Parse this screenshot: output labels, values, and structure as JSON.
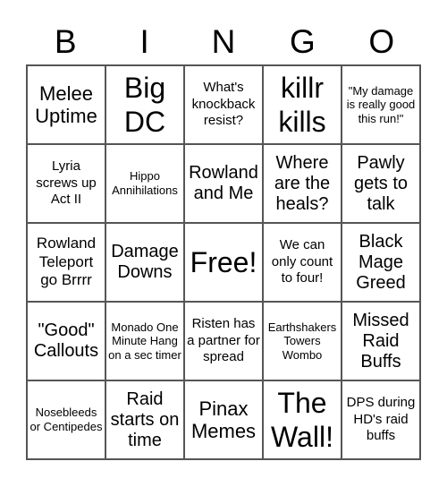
{
  "header": {
    "letters": [
      "B",
      "I",
      "N",
      "G",
      "O"
    ]
  },
  "cells": [
    "Melee Uptime",
    "Big DC",
    "What's knockback resist?",
    "killr kills",
    "\"My damage is really good this run!\"",
    "Lyria screws up Act II",
    "Hippo Annihilations",
    "Rowland and Me",
    "Where are the heals?",
    "Pawly gets to talk",
    "Rowland Teleport go Brrrr",
    "Damage Downs",
    "Free!",
    "We can only count to four!",
    "Black Mage Greed",
    "\"Good\" Callouts",
    "Monado One Minute Hang on a sec timer",
    "Risten has a partner for spread",
    "Earthshakers Towers Wombo",
    "Missed Raid Buffs",
    "Nosebleeds or Centipedes",
    "Raid starts on time",
    "Pinax Memes",
    "The Wall!",
    "DPS during HD's raid buffs"
  ]
}
